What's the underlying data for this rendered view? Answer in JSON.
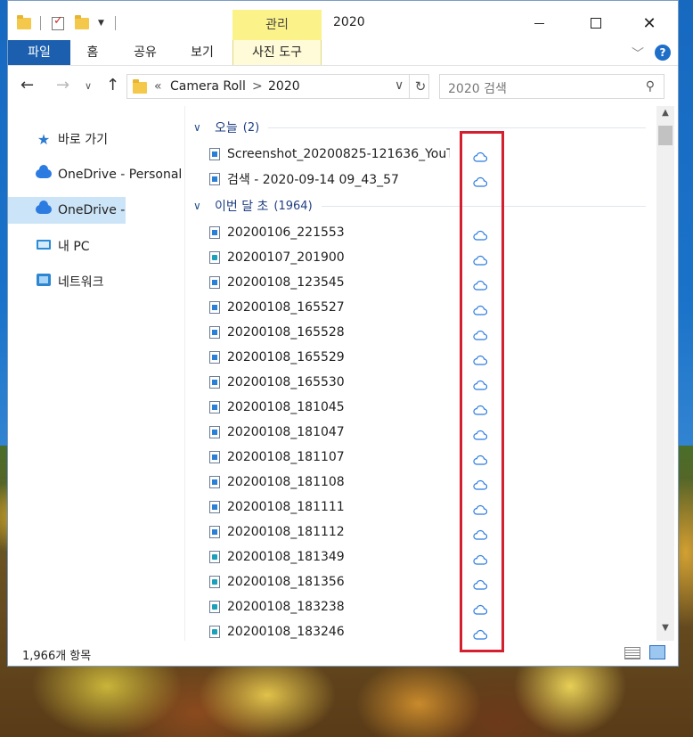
{
  "window": {
    "title": "2020",
    "context_tab_group": "관리",
    "context_tab": "사진 도구"
  },
  "ribbon": {
    "tabs": [
      "파일",
      "홈",
      "공유",
      "보기"
    ]
  },
  "address": {
    "overflow": "«",
    "crumbs": [
      "Camera Roll",
      "2020"
    ],
    "separator": ">"
  },
  "search": {
    "placeholder": "2020 검색"
  },
  "nav": {
    "items": [
      {
        "label": "바로 가기",
        "icon": "star-icon"
      },
      {
        "label": "OneDrive - Personal",
        "icon": "onedrive-icon"
      },
      {
        "label": "OneDrive -",
        "icon": "onedrive-icon",
        "selected": true
      },
      {
        "label": "내 PC",
        "icon": "pc-icon"
      },
      {
        "label": "네트워크",
        "icon": "network-icon"
      }
    ]
  },
  "groups": [
    {
      "title": "오늘",
      "count": "(2)",
      "files": [
        {
          "name": "Screenshot_20200825-121636_YouT...",
          "type": "image"
        },
        {
          "name": "검색 - 2020-09-14 09_43_57",
          "type": "image"
        }
      ]
    },
    {
      "title": "이번 달 초",
      "count": "(1964)",
      "files": [
        {
          "name": "20200106_221553",
          "type": "image"
        },
        {
          "name": "20200107_201900",
          "type": "video"
        },
        {
          "name": "20200108_123545",
          "type": "image"
        },
        {
          "name": "20200108_165527",
          "type": "image"
        },
        {
          "name": "20200108_165528",
          "type": "image"
        },
        {
          "name": "20200108_165529",
          "type": "image"
        },
        {
          "name": "20200108_165530",
          "type": "image"
        },
        {
          "name": "20200108_181045",
          "type": "image"
        },
        {
          "name": "20200108_181047",
          "type": "image"
        },
        {
          "name": "20200108_181107",
          "type": "image"
        },
        {
          "name": "20200108_181108",
          "type": "image"
        },
        {
          "name": "20200108_181111",
          "type": "image"
        },
        {
          "name": "20200108_181112",
          "type": "image"
        },
        {
          "name": "20200108_181349",
          "type": "video"
        },
        {
          "name": "20200108_181356",
          "type": "video"
        },
        {
          "name": "20200108_183238",
          "type": "video"
        },
        {
          "name": "20200108_183246",
          "type": "video"
        }
      ]
    }
  ],
  "status": {
    "item_count": "1,966개 항목"
  },
  "colors": {
    "accent": "#1c5fae",
    "highlight": "#d4202e",
    "context": "#fbf38a",
    "cloud": "#2b7be0"
  }
}
